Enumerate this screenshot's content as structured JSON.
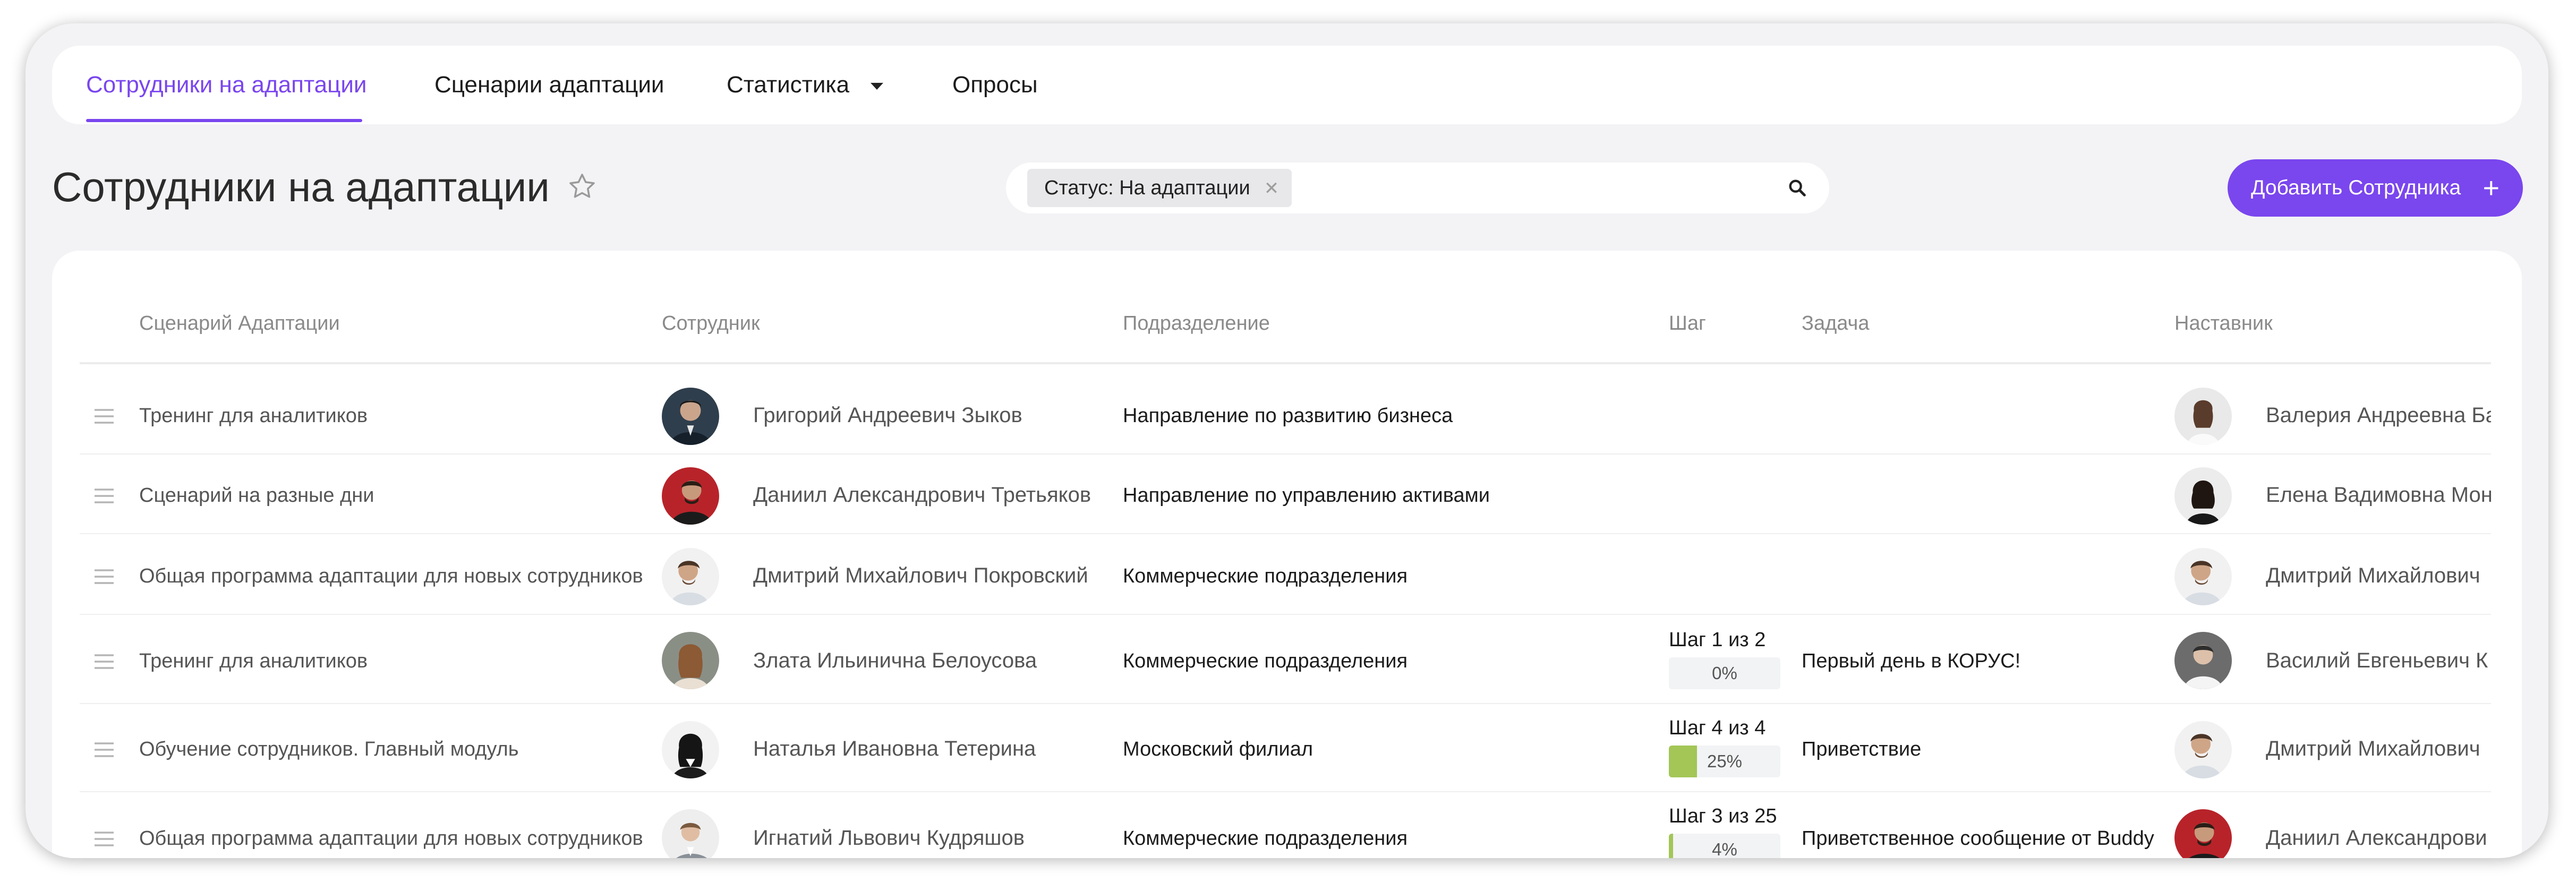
{
  "nav": {
    "tabs": [
      {
        "label": "Сотрудники на адаптации",
        "active": true
      },
      {
        "label": "Сценарии адаптации"
      },
      {
        "label": "Статистика",
        "has_dropdown": true
      },
      {
        "label": "Опросы"
      }
    ]
  },
  "header": {
    "title": "Сотрудники на адаптации",
    "filter_chip": "Статус: На адаптации",
    "add_button": "Добавить Сотрудника",
    "add_icon": "+"
  },
  "colors": {
    "accent": "#7a46ee",
    "progress": "#a3c657"
  },
  "table": {
    "columns": [
      "Сценарий Адаптации",
      "Сотрудник",
      "Подразделение",
      "Шаг",
      "Задача",
      "Наставник"
    ],
    "rows": [
      {
        "scenario": "Тренинг для аналитиков",
        "employee": "Григорий Андреевич Зыков",
        "department": "Направление по развитию бизнеса",
        "step": "",
        "progress": null,
        "task": "",
        "mentor": "Валерия Андреевна Ба"
      },
      {
        "scenario": "Сценарий на разные дни",
        "employee": "Даниил Александрович Третьяков",
        "department": "Направление по управлению активами",
        "step": "",
        "progress": null,
        "task": "",
        "mentor": "Елена Вадимовна Мон"
      },
      {
        "scenario": "Общая программа адаптации для новых сотрудников",
        "employee": "Дмитрий Михайлович Покровский",
        "department": "Коммерческие подразделения",
        "step": "",
        "progress": null,
        "task": "",
        "mentor": "Дмитрий Михайлович"
      },
      {
        "scenario": "Тренинг для аналитиков",
        "employee": "Злата Ильинична Белоусова",
        "department": "Коммерческие подразделения",
        "step": "Шаг 1 из 2",
        "progress": 0,
        "progress_label": "0%",
        "task": "Первый день в КОРУС!",
        "mentor": "Василий Евгеньевич К"
      },
      {
        "scenario": "Обучение сотрудников. Главный модуль",
        "employee": "Наталья Ивановна Тетерина",
        "department": "Московский филиал",
        "step": "Шаг 4 из 4",
        "progress": 25,
        "progress_label": "25%",
        "task": "Приветствие",
        "mentor": "Дмитрий Михайлович"
      },
      {
        "scenario": "Общая программа адаптации для новых сотрудников",
        "employee": "Игнатий Львович Кудряшов",
        "department": "Коммерческие подразделения",
        "step": "Шаг 3 из 25",
        "progress": 4,
        "progress_label": "4%",
        "task": "Приветственное сообщение от Buddy",
        "mentor": "Даниил Александрови"
      }
    ]
  }
}
